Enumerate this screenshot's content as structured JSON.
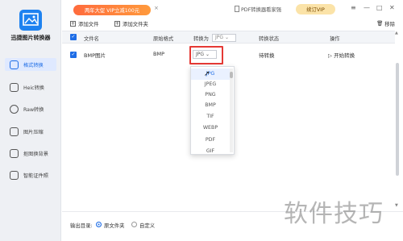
{
  "app": {
    "title": "迅捷图片转换器"
  },
  "sidebar": {
    "items": [
      {
        "label": "格式转换",
        "icon": "format-convert-icon",
        "active": true
      },
      {
        "label": "Heic转换",
        "icon": "heic-icon",
        "active": false
      },
      {
        "label": "Raw转换",
        "icon": "raw-icon",
        "active": false
      },
      {
        "label": "图片压缩",
        "icon": "compress-icon",
        "active": false
      },
      {
        "label": "抠图换背景",
        "icon": "cutout-icon",
        "active": false
      },
      {
        "label": "智能证件照",
        "icon": "id-photo-icon",
        "active": false
      }
    ]
  },
  "topbar": {
    "promo": "两年大促 VIP立减100元",
    "promo_close": "×",
    "ad_text": "PDF转换器看家强",
    "vip_button": "续订VIP",
    "window_buttons": [
      "≡",
      "—",
      "□",
      "✕"
    ]
  },
  "toolbar": {
    "add_file": "添加文件",
    "add_folder": "添加文件夹",
    "clear": "移除"
  },
  "table": {
    "headers": {
      "name": "文件名",
      "orig_format": "原始格式",
      "convert_to": "转换为",
      "convert_to_value": "JPG",
      "status": "转换状态",
      "action": "操作"
    },
    "rows": [
      {
        "name": "BMP图片",
        "orig_format": "BMP",
        "target": "JPG",
        "status": "待转换",
        "action": "开始转换"
      }
    ]
  },
  "dropdown": {
    "options": [
      "JPG",
      "JPEG",
      "PNG",
      "BMP",
      "TIF",
      "WEBP",
      "PDF",
      "GIF"
    ],
    "selected": "JPG"
  },
  "footer": {
    "output_label": "输出目录:",
    "options": [
      "原文件夹",
      "自定义"
    ],
    "selected": "原文件夹"
  },
  "watermark": "软件技巧",
  "colors": {
    "accent": "#1e6de6",
    "highlight_box": "#e53935",
    "promo": "#ff7a3c"
  }
}
